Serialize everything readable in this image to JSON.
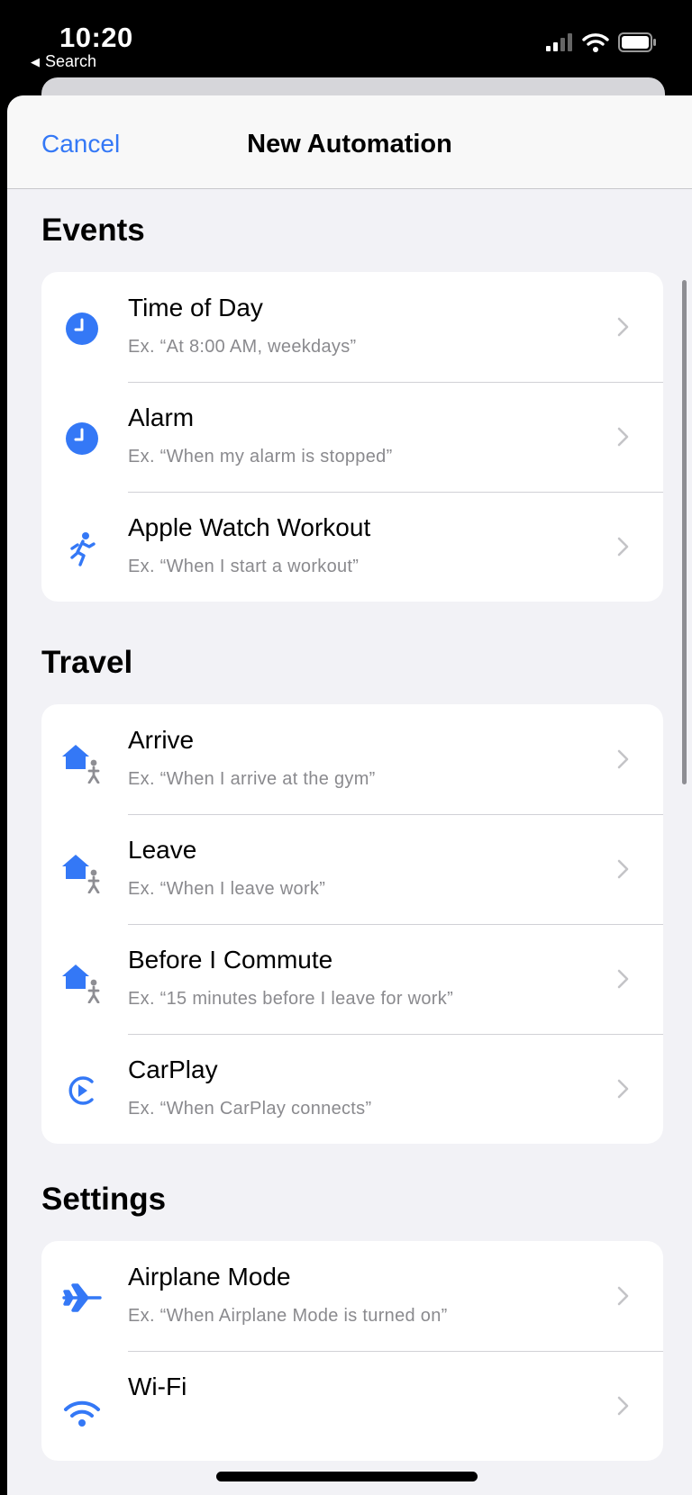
{
  "status_bar": {
    "time": "10:20",
    "back_label": "Search",
    "icons": [
      "cellular-signal-icon",
      "wifi-icon",
      "battery-icon"
    ]
  },
  "nav": {
    "cancel_label": "Cancel",
    "title": "New Automation"
  },
  "colors": {
    "accent": "#3478f6",
    "icon_gray": "#8e8e93",
    "background": "#f2f2f6",
    "card": "#ffffff",
    "subtitle": "#8a8a8e"
  },
  "sections": {
    "events": {
      "title": "Events",
      "items": [
        {
          "title": "Time of Day",
          "subtitle": "Ex. “At 8:00 AM, weekdays”",
          "icon": "clock-icon"
        },
        {
          "title": "Alarm",
          "subtitle": "Ex. “When my alarm is stopped”",
          "icon": "clock-icon"
        },
        {
          "title": "Apple Watch Workout",
          "subtitle": "Ex. “When I start a workout”",
          "icon": "running-figure-icon"
        }
      ]
    },
    "travel": {
      "title": "Travel",
      "items": [
        {
          "title": "Arrive",
          "subtitle": "Ex. “When I arrive at the gym”",
          "icon": "house-person-icon"
        },
        {
          "title": "Leave",
          "subtitle": "Ex. “When I leave work”",
          "icon": "house-person-icon"
        },
        {
          "title": "Before I Commute",
          "subtitle": "Ex. “15 minutes before I leave for work”",
          "icon": "house-person-icon"
        },
        {
          "title": "CarPlay",
          "subtitle": "Ex. “When CarPlay connects”",
          "icon": "carplay-icon"
        }
      ]
    },
    "settings": {
      "title": "Settings",
      "items": [
        {
          "title": "Airplane Mode",
          "subtitle": "Ex. “When Airplane Mode is turned on”",
          "icon": "airplane-icon"
        },
        {
          "title": "Wi-Fi",
          "subtitle": "",
          "icon": "wifi-icon"
        }
      ]
    }
  }
}
